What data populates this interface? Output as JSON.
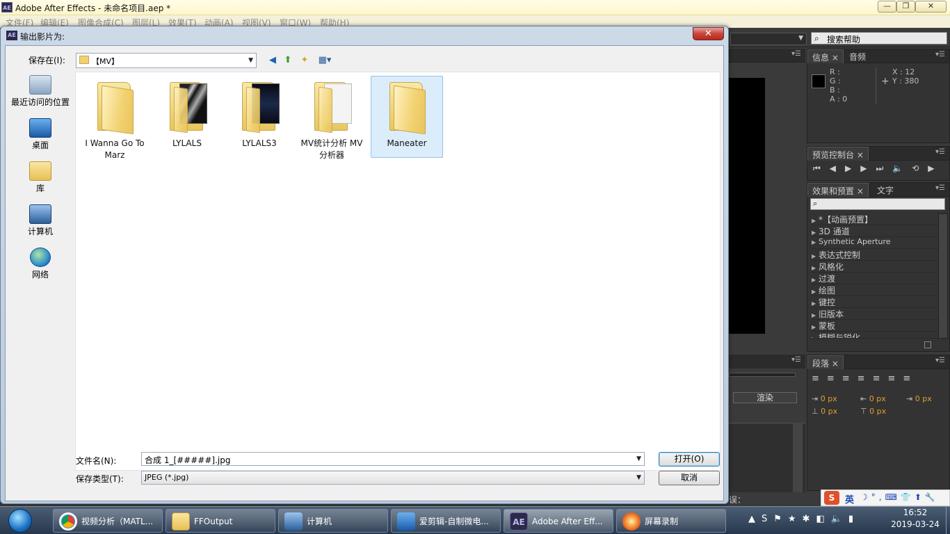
{
  "app": {
    "title": "Adobe After Effects - 未命名项目.aep *",
    "logo": "AE",
    "menu": [
      "文件(F)",
      "编辑(E)",
      "图像合成(C)",
      "图层(L)",
      "效果(T)",
      "动画(A)",
      "视图(V)",
      "窗口(W)",
      "帮助(H)"
    ],
    "search_help": "搜索帮助"
  },
  "info_panel": {
    "tabs": [
      "信息",
      "音频"
    ],
    "r": "R :",
    "g": "G :",
    "b": "B :",
    "a": "A : 0",
    "x": "X : 12",
    "y": "Y : 380"
  },
  "preview_panel": {
    "title": "预览控制台"
  },
  "effects_panel": {
    "tabs": [
      "效果和预置",
      "文字"
    ],
    "items": [
      "*【动画预置】",
      "3D 通道",
      "Synthetic Aperture",
      "表达式控制",
      "风格化",
      "过渡",
      "绘图",
      "键控",
      "旧版本",
      "蒙板",
      "模糊与锐化"
    ]
  },
  "paragraph_panel": {
    "title": "段落",
    "px": "0 px",
    "render_button": "渲染"
  },
  "status_fragment": "误：",
  "dialog": {
    "title": "输出影片为:",
    "icon": "AE",
    "save_in_label": "保存在(I):",
    "save_in_value": "【MV】",
    "places": [
      "最近访问的位置",
      "桌面",
      "库",
      "计算机",
      "网络"
    ],
    "folders": [
      {
        "name": "I Wanna Go To Marz",
        "has_image": false
      },
      {
        "name": "LYLALS",
        "has_image": true
      },
      {
        "name": "LYLALS3",
        "has_image": true
      },
      {
        "name": "MV统计分析 MV分析器",
        "has_image": true
      },
      {
        "name": "Maneater",
        "has_image": false,
        "selected": true
      }
    ],
    "filename_label": "文件名(N):",
    "filename_value": "合成 1_[#####].jpg",
    "filetype_label": "保存类型(T):",
    "filetype_value": "JPEG (*.jpg)",
    "open_button": "打开(O)",
    "cancel_button": "取消"
  },
  "taskbar": {
    "items": [
      "视频分析（MATL...",
      "FFOutput",
      "计算机",
      "爱剪辑-自制微电...",
      "Adobe After Eff...",
      "屏幕录制"
    ],
    "ime": "英",
    "time": "16:52",
    "date": "2019-03-24"
  }
}
